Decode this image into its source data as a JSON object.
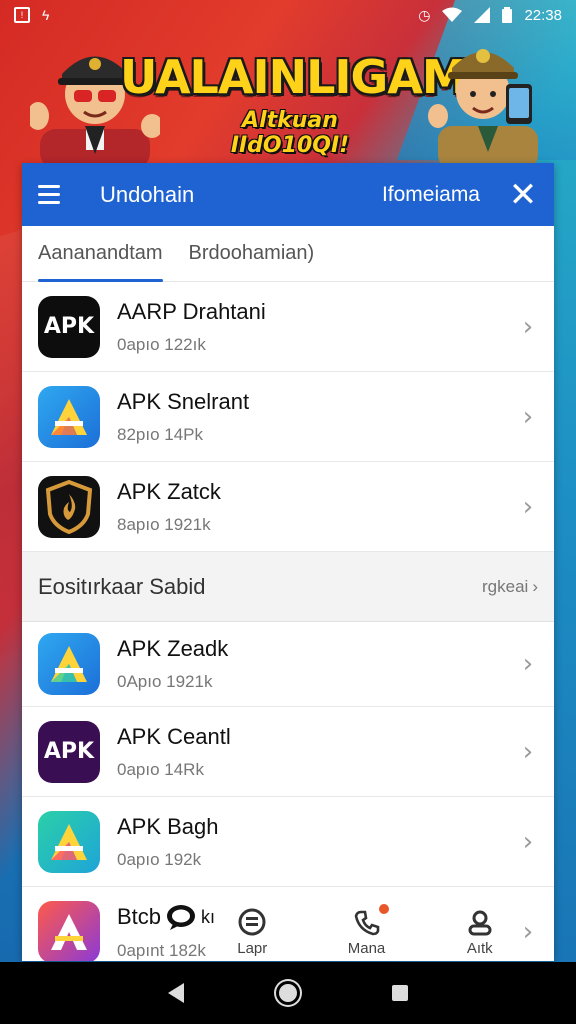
{
  "status_bar": {
    "time": "22:38",
    "icon_left": [
      "notification-icon",
      "bolt-icon"
    ],
    "icon_right": [
      "alarm-icon",
      "wifi-icon",
      "signal-icon",
      "battery-icon"
    ]
  },
  "banner": {
    "title": "UALAINLIGAM",
    "subtitle": "Altkuan IIdO10QI!"
  },
  "appbar": {
    "title": "Undohain",
    "right_label": "Ifomeiama"
  },
  "tabs": [
    {
      "label": "Aananandtam"
    },
    {
      "label": "Brdoohamian)"
    }
  ],
  "list1": [
    {
      "name": "AARP Drahtani",
      "meta": "0apıo 122ık",
      "icon": "apk-dark-icon"
    },
    {
      "name": "APK Snelrant",
      "meta": "82pıo 14Pk",
      "icon": "apk-blue-triangle-icon"
    },
    {
      "name": "APK Zatck",
      "meta": "8apıo 1921k",
      "icon": "shield-flame-icon"
    }
  ],
  "section": {
    "title": "Eositırkaar Sabid",
    "more": "rgkeai",
    "more_arrow": "›"
  },
  "list2": [
    {
      "name": "APK Zeadk",
      "meta": "0Apıo 1921k",
      "icon": "apk-blue-triangle-icon"
    },
    {
      "name": "APK Ceantl",
      "meta": "0apıo 14Rk",
      "icon": "apk-purple-icon"
    },
    {
      "name": "APK Bagh",
      "meta": "0apıo 192k",
      "icon": "apk-green-triangle-icon"
    }
  ],
  "last_item": {
    "name": "Btcb",
    "name_suffix": "kı",
    "meta": "0apınt 182k",
    "icon": "apk-red-triangle-icon"
  },
  "bottom_nav": [
    {
      "label": "Lapr",
      "icon": "badge-icon"
    },
    {
      "label": "Mana",
      "icon": "phone-icon"
    },
    {
      "label": "Aıtk",
      "icon": "user-icon"
    }
  ],
  "chevron": "›",
  "colors": {
    "primary": "#1f63d3",
    "banner_yellow": "#ffd21a",
    "nav_bg": "#000000"
  }
}
